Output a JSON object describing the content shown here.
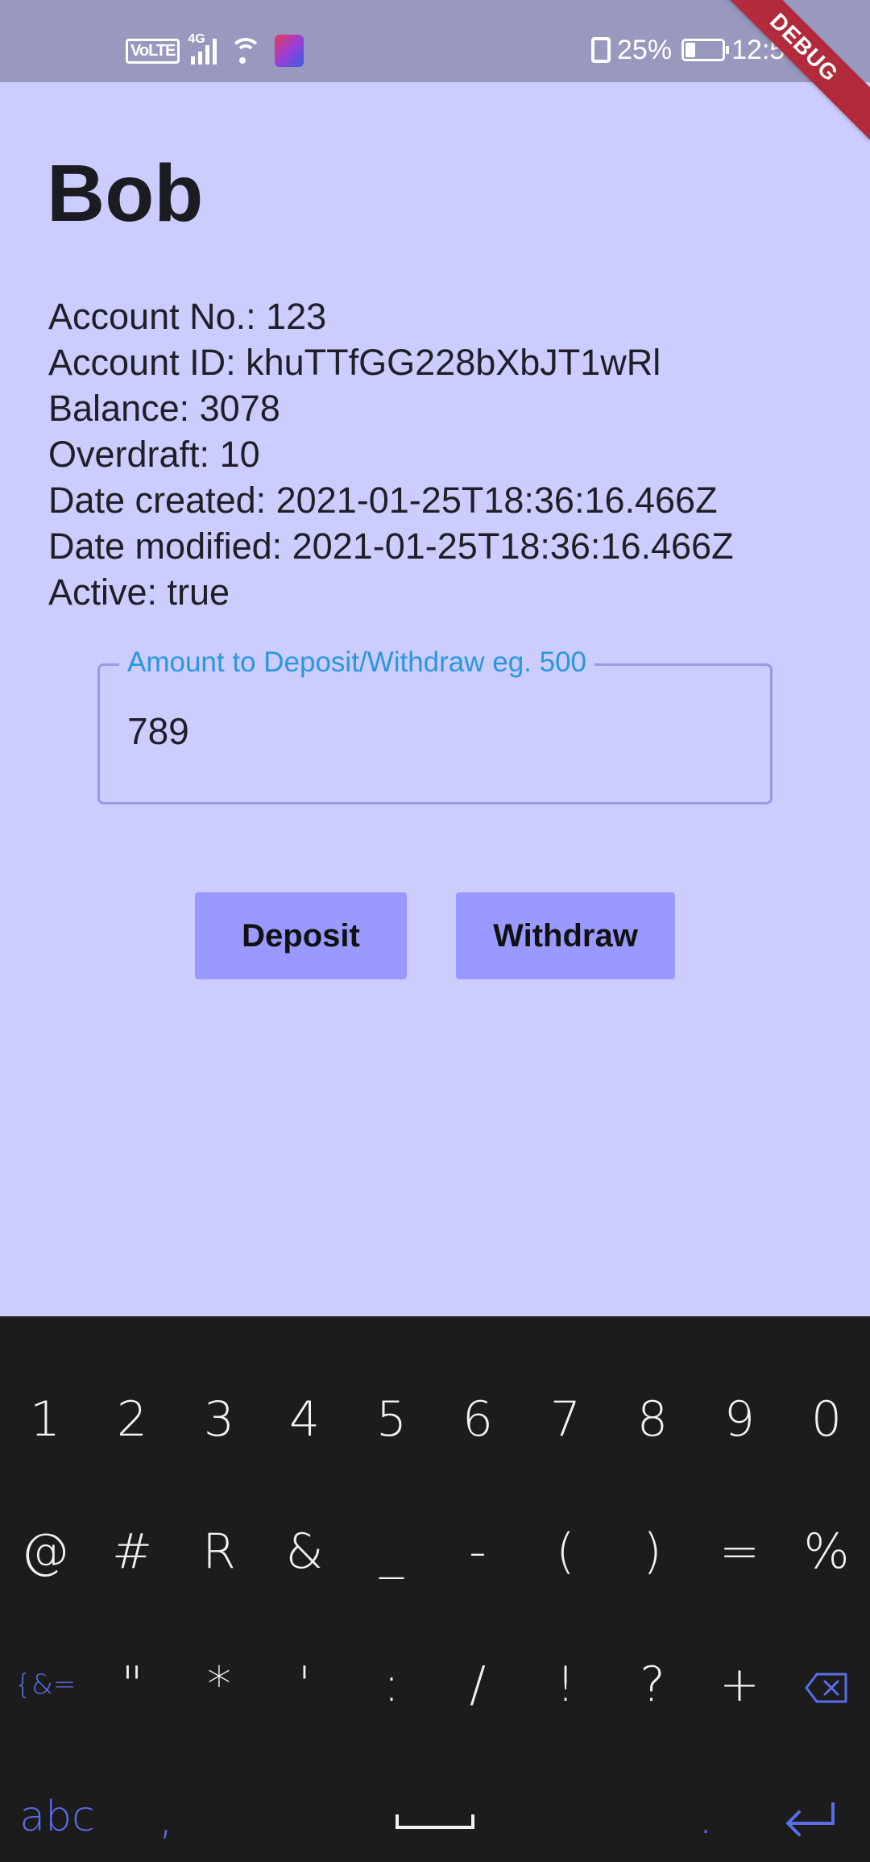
{
  "status_bar": {
    "volte": "VoLTE",
    "network": "4G",
    "battery_percent": "25%",
    "battery_level": 0.25,
    "time": "12:53",
    "debug_banner": "DEBUG"
  },
  "account": {
    "name": "Bob",
    "lines": [
      "Account No.: 123",
      "Account ID: khuTTfGG228bXbJT1wRl",
      "Balance: 3078",
      "Overdraft: 10",
      "Date created: 2021-01-25T18:36:16.466Z",
      "Date modified: 2021-01-25T18:36:16.466Z",
      "Active: true"
    ]
  },
  "amount_field": {
    "label": "Amount to Deposit/Withdraw eg. 500",
    "value": "789"
  },
  "buttons": {
    "deposit": "Deposit",
    "withdraw": "Withdraw"
  },
  "keyboard": {
    "row1": [
      "1",
      "2",
      "3",
      "4",
      "5",
      "6",
      "7",
      "8",
      "9",
      "0"
    ],
    "row2": [
      "@",
      "#",
      "R",
      "&",
      "_",
      "-",
      "(",
      ")",
      "=",
      "%"
    ],
    "row3": [
      "{&=",
      "\"",
      "*",
      "'",
      ":",
      "/",
      "!",
      "?",
      "+"
    ],
    "row4": {
      "abc": "abc",
      "comma": ",",
      "period": "."
    },
    "icons": {
      "backspace": "backspace-icon",
      "space": "space-bar-icon",
      "enter": "enter-icon"
    },
    "accent_color": "#5a6de8"
  },
  "colors": {
    "background": "#ccccfe",
    "status_bar": "#9999bf",
    "button": "#9999ff",
    "field_label": "#2997e0",
    "keyboard": "#1c1c1c"
  }
}
